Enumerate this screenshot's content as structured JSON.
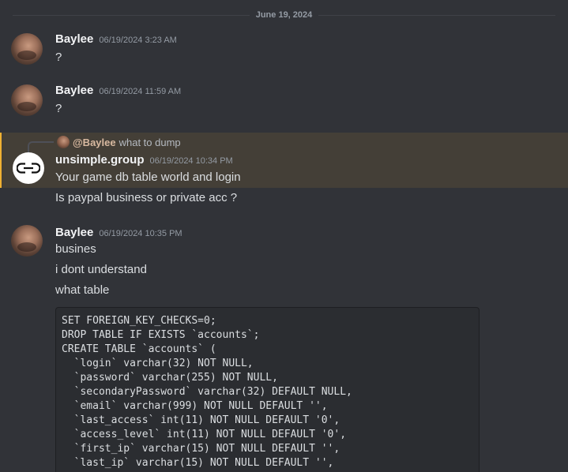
{
  "date_divider": "June 19, 2024",
  "messages": [
    {
      "author": "Baylee",
      "timestamp": "06/19/2024 3:23 AM",
      "lines": [
        "?"
      ]
    },
    {
      "author": "Baylee",
      "timestamp": "06/19/2024 11:59 AM",
      "lines": [
        "?"
      ]
    },
    {
      "reply": {
        "mention": "@Baylee",
        "text": "what to dump"
      },
      "author": "unsimple.group",
      "timestamp": "06/19/2024 10:34 PM",
      "lines": [
        "Your game db table world and login",
        "Is paypal business or private acc ?"
      ],
      "highlighted": true
    },
    {
      "author": "Baylee",
      "timestamp": "06/19/2024 10:35 PM",
      "lines": [
        "busines",
        "i dont understand",
        "what table"
      ],
      "code": "SET FOREIGN_KEY_CHECKS=0;\nDROP TABLE IF EXISTS `accounts`;\nCREATE TABLE `accounts` (\n  `login` varchar(32) NOT NULL,\n  `password` varchar(255) NOT NULL,\n  `secondaryPassword` varchar(32) DEFAULT NULL,\n  `email` varchar(999) NOT NULL DEFAULT '',\n  `last_access` int(11) NOT NULL DEFAULT '0',\n  `access_level` int(11) NOT NULL DEFAULT '0',\n  `first_ip` varchar(15) NOT NULL DEFAULT '',\n  `last_ip` varchar(15) NOT NULL DEFAULT '',"
    }
  ],
  "colors": {
    "background": "#313338",
    "mention_highlight": "#f0b132"
  }
}
